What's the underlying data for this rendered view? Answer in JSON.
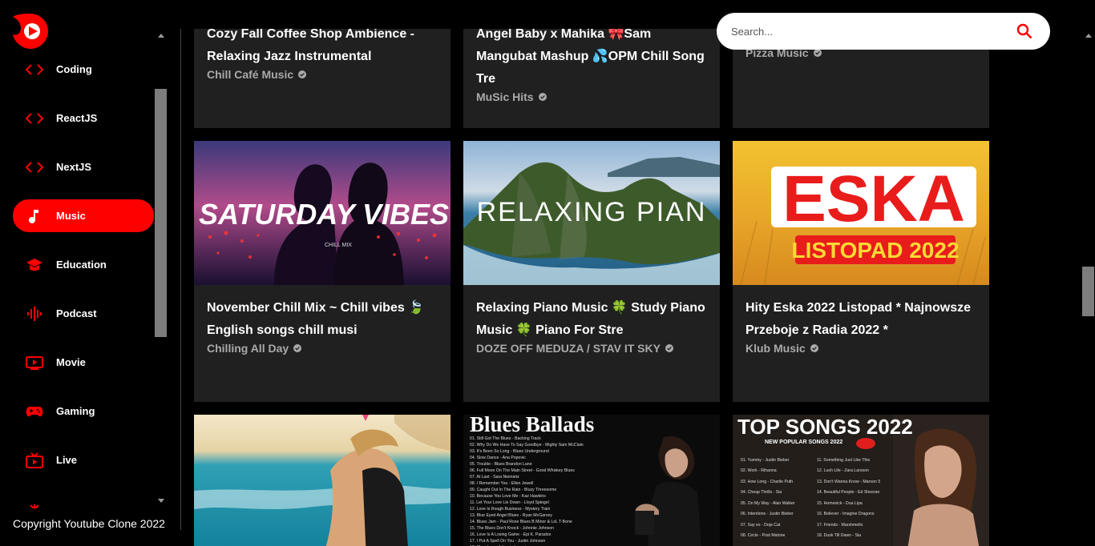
{
  "sidebar": {
    "items": [
      {
        "label": "Coding",
        "icon": "code-icon"
      },
      {
        "label": "ReactJS",
        "icon": "code-icon"
      },
      {
        "label": "NextJS",
        "icon": "code-icon"
      },
      {
        "label": "Music",
        "icon": "music-note-icon",
        "active": true
      },
      {
        "label": "Education",
        "icon": "graduation-cap-icon"
      },
      {
        "label": "Podcast",
        "icon": "podcast-icon"
      },
      {
        "label": "Movie",
        "icon": "movie-icon"
      },
      {
        "label": "Gaming",
        "icon": "gamepad-icon"
      },
      {
        "label": "Live",
        "icon": "live-tv-icon"
      }
    ],
    "copyright": "Copyright Youtube Clone 2022"
  },
  "search": {
    "placeholder": "Search..."
  },
  "videos": [
    {
      "title": "Cozy Fall Coffee Shop Ambience - Relaxing Jazz Instrumental",
      "channel": "Chill Café Music"
    },
    {
      "title": "Angel Baby x Mahika 🎀Sam Mangubat Mashup 💦OPM Chill Song Tre",
      "channel": "MuSic Hits"
    },
    {
      "title": "",
      "channel": "Pizza Music"
    },
    {
      "title": "November Chill Mix ~ Chill vibes 🍃 English songs chill musi",
      "channel": "Chilling All Day",
      "thumb_text": "SATURDAY VIBES",
      "thumb_sub": "CHILL MIX"
    },
    {
      "title": "Relaxing Piano Music 🍀 Study Piano Music 🍀 Piano For Stre",
      "channel": "DOZE OFF MEDUZA / STAV IT SKY",
      "thumb_text": "RELAXING PIAN"
    },
    {
      "title": "Hity Eska 2022 Listopad * Najnowsze Przeboje z Radia 2022 *",
      "channel": "Klub Music",
      "thumb_text": "ESKA",
      "thumb_sub": "LISTOPAD 2022"
    },
    {
      "title": "",
      "channel": ""
    },
    {
      "title": "",
      "channel": "",
      "thumb_text": "Blues Ballads"
    },
    {
      "title": "",
      "channel": "",
      "thumb_text": "TOP SONGS 2022",
      "thumb_sub": "NEW POPULAR SONGS 2022"
    }
  ],
  "colors": {
    "accent": "#ff0000",
    "card_bg": "#202020",
    "channel_text": "#aaaaaa"
  }
}
